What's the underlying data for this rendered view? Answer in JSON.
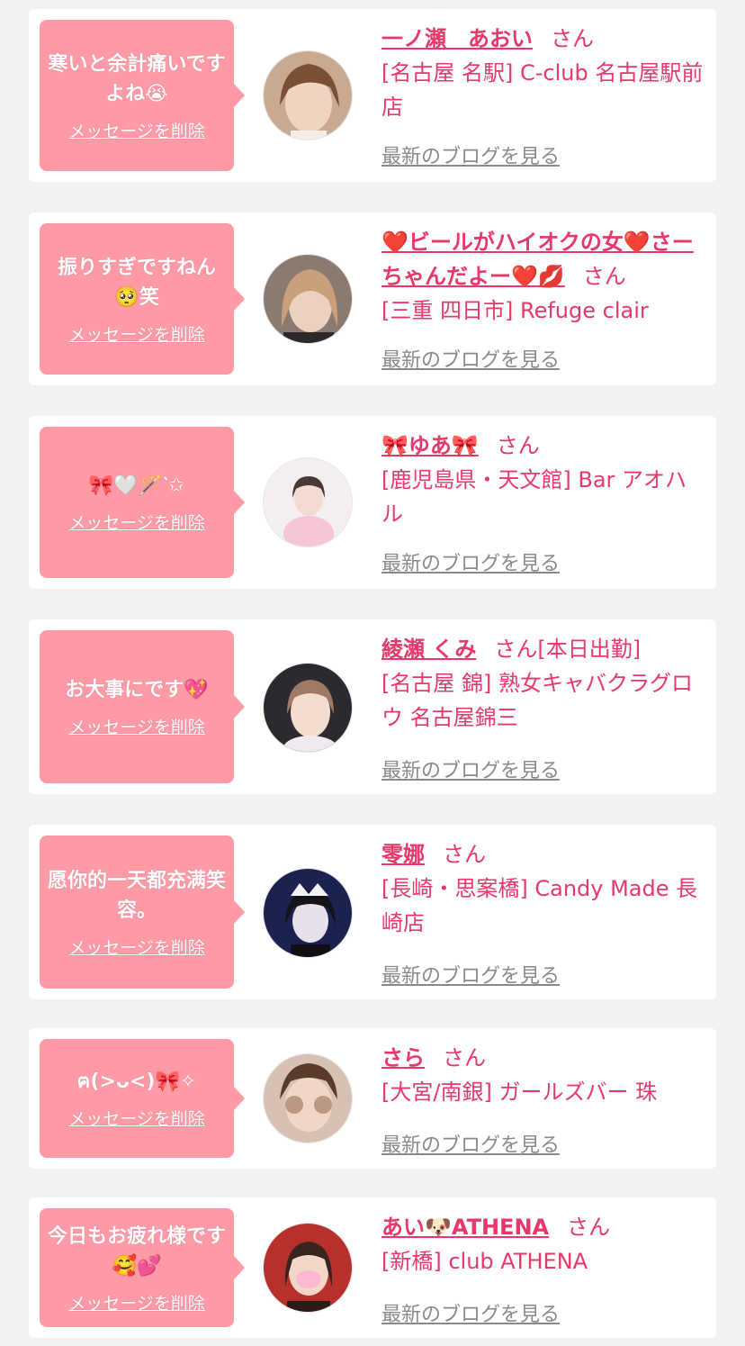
{
  "delete_label": "メッセージを削除",
  "blog_label": "最新のブログを見る",
  "san_label": "さん",
  "colors": {
    "accent": "#e8386a",
    "bubble": "#ff9aa6",
    "muted": "#8a8a8a",
    "bg": "#f2f2f2"
  },
  "cards": [
    {
      "message": "寒いと余計痛いですよね😭",
      "name": "一ノ瀬　あおい",
      "extra": "",
      "shop": "[名古屋 名駅] C-club 名古屋駅前店"
    },
    {
      "message": "振りすぎですねん🥺笑",
      "name": "❤️ビールがハイオクの女❤️さーちゃんだよー❤️💋",
      "extra": "",
      "shop": "[三重 四日市] Refuge clair"
    },
    {
      "message": "🎀🤍🪄‵✩",
      "name": "🎀ゆあ🎀",
      "extra": "",
      "shop": "[鹿児島県・天文館] Bar アオハル"
    },
    {
      "message": "お大事にです💖",
      "name": "綾瀬 くみ",
      "extra": "[本日出勤]",
      "shop": "[名古屋 錦] 熟女キャバクラグロウ 名古屋錦三"
    },
    {
      "message": "愿你的一天都充满笑容。",
      "name": "零娜",
      "extra": "",
      "shop": "[長崎・思案橋] Candy Made 長崎店"
    },
    {
      "message": "ฅ(>ᴗ<)🎀✧",
      "name": "さら",
      "extra": "",
      "shop": "[大宮/南銀] ガールズバー 珠"
    },
    {
      "message": "今日もお疲れ様です🥰💕",
      "name": "あい🐶ATHENA",
      "extra": "",
      "shop": "[新橋] club ATHENA"
    }
  ]
}
